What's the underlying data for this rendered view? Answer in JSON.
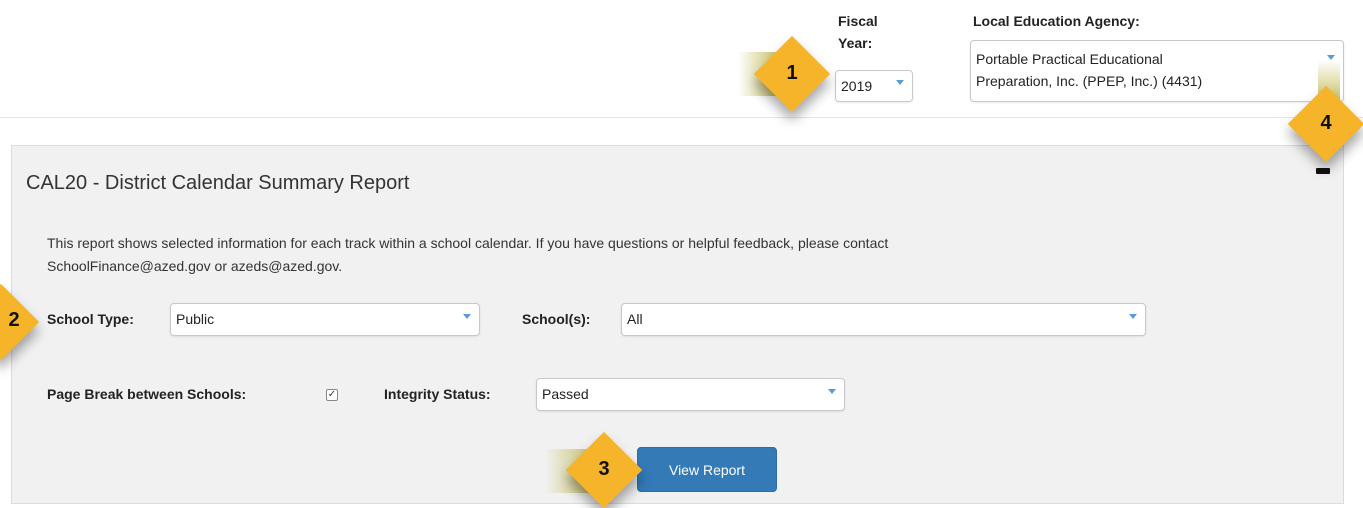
{
  "header": {
    "fiscal_year_label_line1": "Fiscal",
    "fiscal_year_label_line2": "Year:",
    "fiscal_year_value": "2019",
    "lea_label": "Local Education Agency:",
    "lea_value_line1": "Portable Practical Educational",
    "lea_value_line2": "Preparation, Inc. (PPEP, Inc.) (4431)"
  },
  "report": {
    "title": "CAL20 - District Calendar Summary Report",
    "description_line1": "This report shows selected information for each track within a school calendar. If you have questions or helpful feedback, please contact",
    "description_line2": "SchoolFinance@azed.gov or azeds@azed.gov.",
    "collapse_symbol": "−"
  },
  "filters": {
    "school_type_label": "School Type:",
    "school_type_value": "Public",
    "schools_label": "School(s):",
    "schools_value": "All",
    "page_break_label": "Page Break between Schools:",
    "page_break_checked": "✓",
    "integrity_status_label": "Integrity Status:",
    "integrity_status_value": "Passed"
  },
  "actions": {
    "view_report_label": "View Report"
  },
  "callouts": {
    "marker1": "1",
    "marker2": "2",
    "marker3": "3",
    "marker4": "4"
  },
  "colors": {
    "accent": "#337ab7",
    "callout": "#f6b42b",
    "panel_bg": "#f1f1f1"
  }
}
